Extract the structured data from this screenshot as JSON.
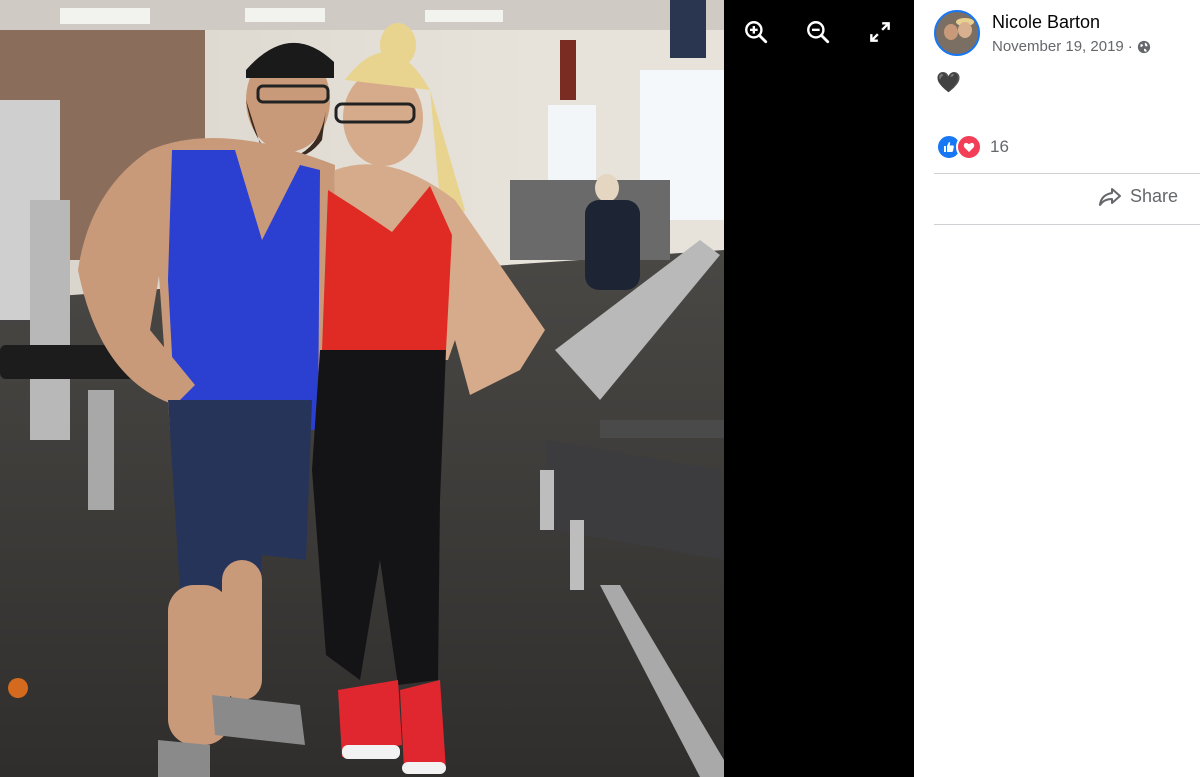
{
  "viewer": {
    "photo_alt": "",
    "zoom_in_icon": "zoom-in-icon",
    "zoom_out_icon": "zoom-out-icon",
    "fullscreen_icon": "fullscreen-icon"
  },
  "post": {
    "author": "Nicole Barton",
    "date": "November 19, 2019",
    "date_separator": "·",
    "privacy_icon": "globe-icon",
    "caption": "🖤",
    "reaction_icons": [
      "like-icon",
      "love-icon"
    ],
    "reaction_count": "16",
    "share_label": "Share",
    "share_icon": "share-arrow-icon"
  },
  "colors": {
    "accent": "#1877f2",
    "love": "#f33e58",
    "secondary_text": "#65676b",
    "viewer_bg": "#000000"
  }
}
